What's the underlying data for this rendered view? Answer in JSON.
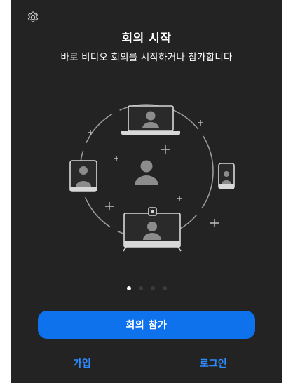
{
  "header": {
    "settings_icon": "gear-icon"
  },
  "main": {
    "title": "회의 시작",
    "subtitle": "바로 비디오 회의를 시작하거나 참가합니다",
    "illustration_icons": [
      "laptop-icon",
      "tablet-icon",
      "phone-icon",
      "room-system-icon",
      "user-icon"
    ],
    "pager": {
      "pages": 4,
      "current": 1
    }
  },
  "actions": {
    "join_label": "회의 참가",
    "signup_label": "가입",
    "login_label": "로그인"
  },
  "colors": {
    "background": "#232323",
    "accent": "#0e72ed",
    "link": "#2d8cff"
  }
}
